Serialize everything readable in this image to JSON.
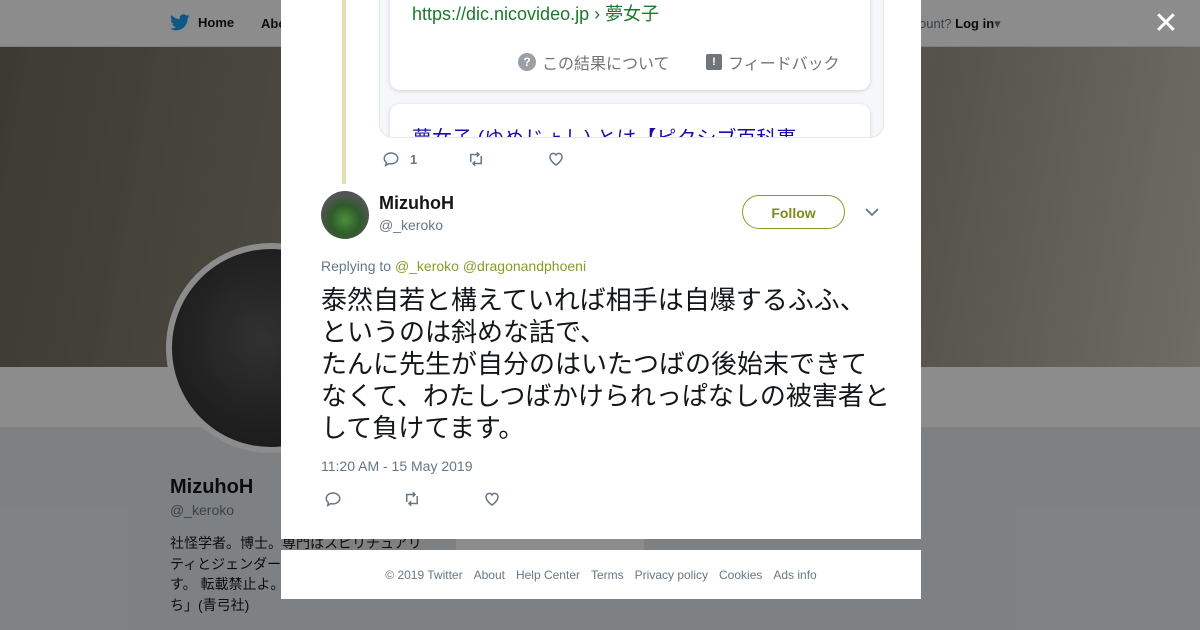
{
  "nav": {
    "home_label": "Home",
    "about_label": "Abo",
    "account_prompt": "ccount?",
    "login_label": "Log in"
  },
  "profile": {
    "name": "MizuhoH",
    "handle": "@_keroko",
    "bio": "社怪学者。博士。専門はスピリチュアリティとジェンダー。転載禁止。ています。 転載禁止よ。「占いをまとう少女たち」(青弓社)"
  },
  "previous_tweet": {
    "embed_url": "https://dic.nicovideo.jp › 夢女子",
    "embed_about": "この結果について",
    "embed_feedback": "フィードバック",
    "embed_next_title": "夢女子 (ゆめじょし) とは【ピクシブ百科事",
    "reply_count": "1"
  },
  "tweet": {
    "author_name": "MizuhoH",
    "author_handle": "@_keroko",
    "follow_label": "Follow",
    "replying_prefix": "Replying to ",
    "replying_mentions": "@_keroko @dragonandphoeni",
    "text": "泰然自若と構えていれば相手は自爆するふふ、というのは斜めな話で、\nたんに先生が自分のはいたつばの後始末できてなくて、わたしつばかけられっぱなしの被害者として負けてます。",
    "timestamp": "11:20 AM - 15 May 2019"
  },
  "footer": {
    "links": [
      "© 2019 Twitter",
      "About",
      "Help Center",
      "Terms",
      "Privacy policy",
      "Cookies",
      "Ads info"
    ]
  },
  "colors": {
    "accent": "#8a9a2c",
    "thread_line": "#dfe2b0",
    "text_primary": "#14171a",
    "text_secondary": "#657786"
  },
  "icons": [
    "twitter-bird-icon",
    "close-icon",
    "reply-icon",
    "retweet-icon",
    "like-icon",
    "chevron-down-icon",
    "help-icon",
    "feedback-icon"
  ]
}
